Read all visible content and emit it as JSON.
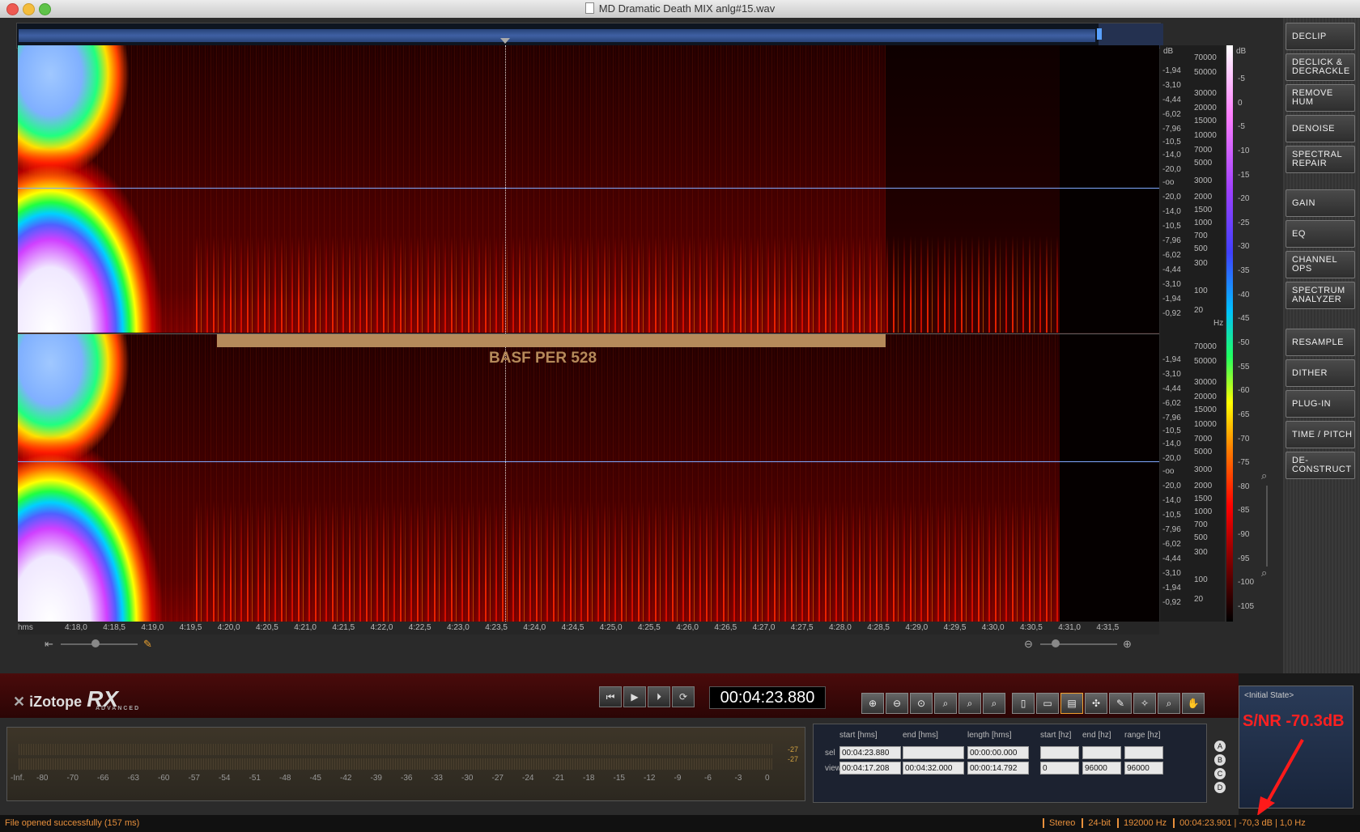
{
  "window": {
    "title": "MD Dramatic Death MIX anlg#15.wav"
  },
  "modules": [
    "DECLIP",
    "DECLICK & DECRACKLE",
    "REMOVE HUM",
    "DENOISE",
    "SPECTRAL REPAIR",
    "GAIN",
    "EQ",
    "CHANNEL OPS",
    "SPECTRUM ANALYZER",
    "RESAMPLE",
    "DITHER",
    "PLUG-IN",
    "TIME / PITCH",
    "DE-CONSTRUCT"
  ],
  "annotation": {
    "tape_label": "BASF PER 528",
    "snr_label": "S/NR -70.3dB"
  },
  "scales": {
    "db_unit": "dB",
    "hz_unit": "Hz",
    "db_ticks": [
      "-1,94",
      "-3,10",
      "-4,44",
      "-6,02",
      "-7,96",
      "-10,5",
      "-14,0",
      "-20,0",
      "-oo",
      "-20,0",
      "-14,0",
      "-10,5",
      "-7,96",
      "-6,02",
      "-4,44",
      "-3,10",
      "-1,94",
      "-0,92"
    ],
    "hz_ticks": [
      "70000",
      "50000",
      "30000",
      "20000",
      "15000",
      "10000",
      "7000",
      "5000",
      "3000",
      "2000",
      "1500",
      "1000",
      "700",
      "500",
      "300",
      "100",
      "20"
    ],
    "colorbar_ticks": [
      "-5",
      "0",
      "-5",
      "-10",
      "-15",
      "-20",
      "-25",
      "-30",
      "-35",
      "-40",
      "-45",
      "-50",
      "-55",
      "-60",
      "-65",
      "-70",
      "-75",
      "-80",
      "-85",
      "-90",
      "-95",
      "-100",
      "-105"
    ]
  },
  "time_axis": {
    "unit": "hms",
    "labels": [
      "4:18,0",
      "4:18,5",
      "4:19,0",
      "4:19,5",
      "4:20,0",
      "4:20,5",
      "4:21,0",
      "4:21,5",
      "4:22,0",
      "4:22,5",
      "4:23,0",
      "4:23,5",
      "4:24,0",
      "4:24,5",
      "4:25,0",
      "4:25,5",
      "4:26,0",
      "4:26,5",
      "4:27,0",
      "4:27,5",
      "4:28,0",
      "4:28,5",
      "4:29,0",
      "4:29,5",
      "4:30,0",
      "4:30,5",
      "4:31,0",
      "4:31,5"
    ]
  },
  "logo": {
    "brand": "iZotope",
    "product": "RX",
    "edition": "ADVANCED"
  },
  "transport": {
    "timecode": "00:04:23.880"
  },
  "meter": {
    "labels": [
      "-Inf.",
      "-80",
      "-70",
      "-66",
      "-63",
      "-60",
      "-57",
      "-54",
      "-51",
      "-48",
      "-45",
      "-42",
      "-39",
      "-36",
      "-33",
      "-30",
      "-27",
      "-24",
      "-21",
      "-18",
      "-15",
      "-12",
      "-9",
      "-6",
      "-3",
      "0"
    ],
    "peak_top": "-27",
    "peak_bottom": "-27"
  },
  "selection": {
    "headers": [
      "start [hms]",
      "end [hms]",
      "length [hms]",
      "start [hz]",
      "end [hz]",
      "range [hz]"
    ],
    "sel": {
      "label": "sel",
      "start": "00:04:23.880",
      "end": "",
      "length": "00:00:00.000",
      "start_hz": "",
      "end_hz": "",
      "range_hz": ""
    },
    "view": {
      "label": "view",
      "start": "00:04:17.208",
      "end": "00:04:32.000",
      "length": "00:00:14.792",
      "start_hz": "0",
      "end_hz": "96000",
      "range_hz": "96000"
    }
  },
  "history": {
    "item": "<Initial State>"
  },
  "snapshots": [
    "A",
    "B",
    "C",
    "D"
  ],
  "status": {
    "message": "File opened successfully (157 ms)",
    "channels": "Stereo",
    "bitdepth": "24-bit",
    "samplerate": "192000 Hz",
    "cursor": "00:04:23.901 | -70,3 dB | 1,0 Hz"
  }
}
